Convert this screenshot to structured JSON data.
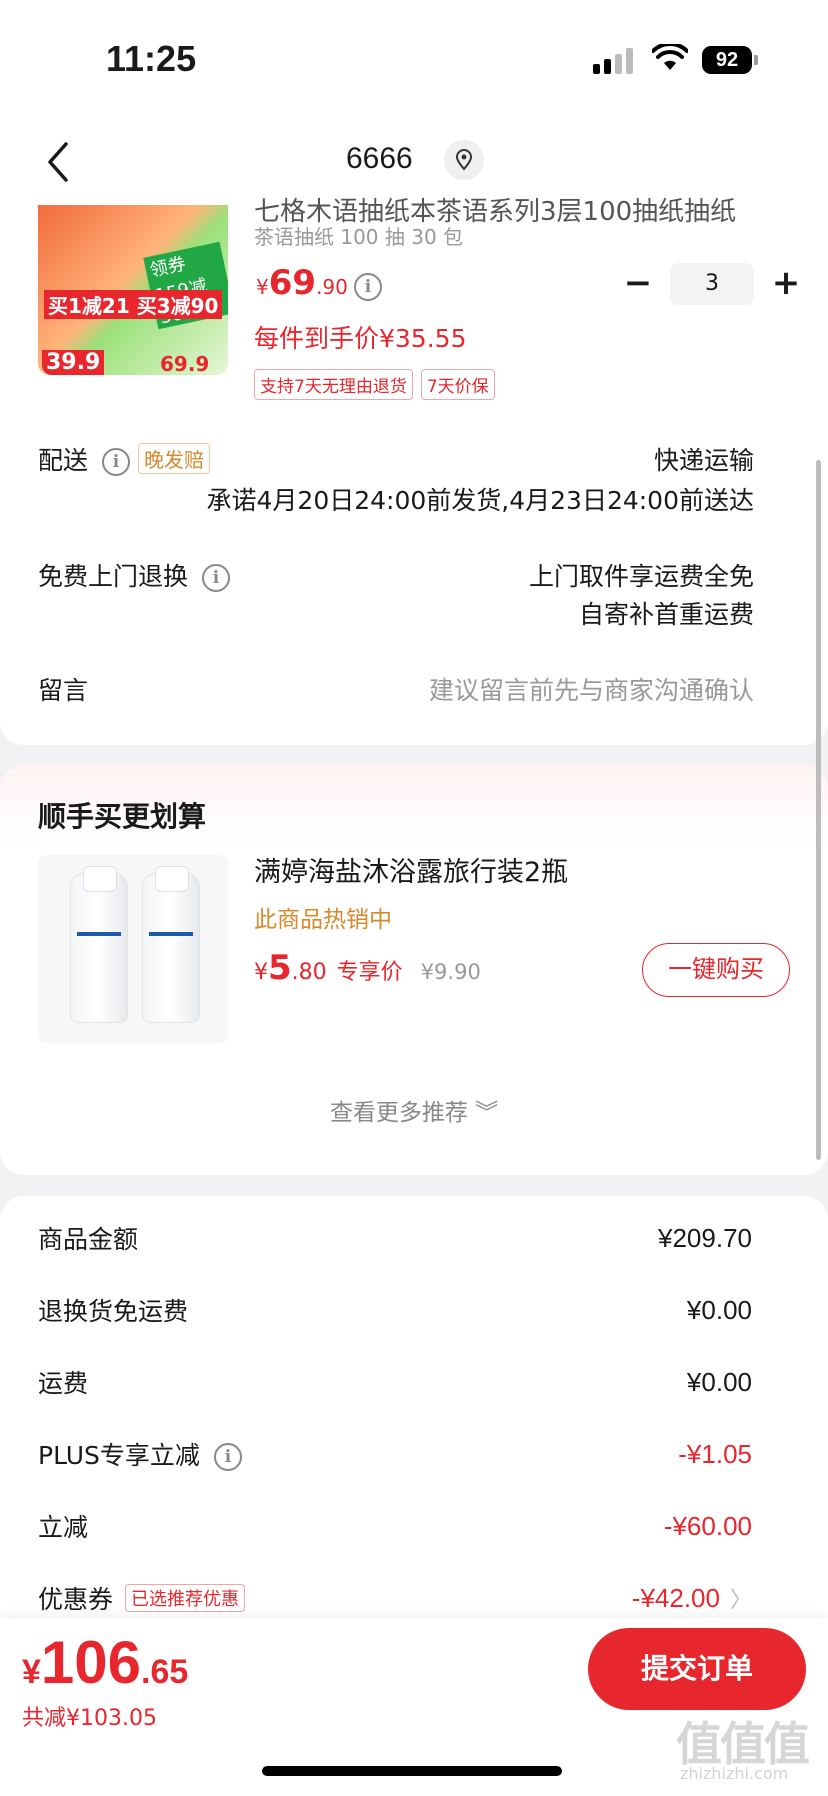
{
  "status_bar": {
    "time": "11:25",
    "battery": "92"
  },
  "nav": {
    "title": "6666"
  },
  "product": {
    "title": "七格木语抽纸本茶语系列3层100抽纸抽纸",
    "spec": "茶语抽纸 100 抽 30 包",
    "image_badges": [
      "买1减21 买3减90",
      "39.9",
      "69.9",
      "领券159减30"
    ],
    "price_currency": "¥",
    "price_int": "69",
    "price_dec": ".90",
    "quantity": "3",
    "unit_price": "每件到手价¥35.55",
    "tags": [
      "支持7天无理由退货",
      "7天价保"
    ]
  },
  "delivery": {
    "label": "配送",
    "tag": "晚发赔",
    "method": "快递运输",
    "promise": "承诺4月20日24:00前发货,4月23日24:00前送达"
  },
  "return_service": {
    "label": "免费上门退换",
    "line1": "上门取件享运费全免",
    "line2": "自寄补首重运费"
  },
  "message": {
    "label": "留言",
    "placeholder": "建议留言前先与商家沟通确认"
  },
  "recommend": {
    "title": "顺手买更划算",
    "item_name": "满婷海盐沐浴露旅行装2瓶",
    "hot": "此商品热销中",
    "price_currency": "¥",
    "price_int": "5",
    "price_dec": ".80",
    "price_label": "专享价",
    "original_price": "¥9.90",
    "buy_label": "一键购买",
    "more_label": "查看更多推荐 ︾"
  },
  "summary": {
    "rows": [
      {
        "label": "商品金额",
        "value": "¥209.70"
      },
      {
        "label": "退换货免运费",
        "value": "¥0.00"
      },
      {
        "label": "运费",
        "value": "¥0.00"
      },
      {
        "label": "PLUS专享立减",
        "value": "-¥1.05"
      },
      {
        "label": "立减",
        "value": "-¥60.00"
      },
      {
        "label": "优惠券",
        "tag": "已选推荐优惠",
        "value": "-¥42.00"
      }
    ]
  },
  "footer": {
    "currency": "¥",
    "total_int": "106",
    "total_dec": ".65",
    "saved": "共减¥103.05",
    "submit_label": "提交订单"
  },
  "watermark": {
    "text": "值值值",
    "url": "zhizhizhi.com"
  },
  "colors": {
    "accent": "#e8262d",
    "orange": "#d68a2c"
  }
}
